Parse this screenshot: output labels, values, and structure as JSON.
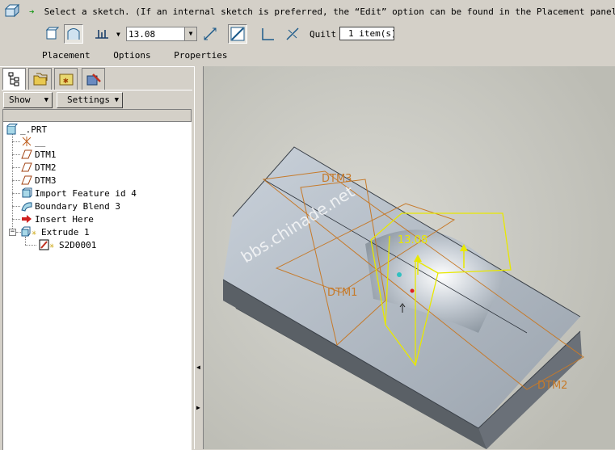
{
  "dashboard": {
    "message": "Select a sketch. (If an internal sketch is preferred, the “Edit” option can be found in the Placement panel.)",
    "depth_value": "13.08",
    "quilt_label": "Quilt",
    "quilt_value": "1 item(s)",
    "slideups": {
      "placement": "Placement",
      "options": "Options",
      "properties": "Properties"
    }
  },
  "tree_toolbar": {
    "show": "Show",
    "settings": "Settings"
  },
  "tree": {
    "root": "_.PRT",
    "items": [
      {
        "label": "__",
        "icon": "csys-icon"
      },
      {
        "label": "DTM1",
        "icon": "datum-plane-icon"
      },
      {
        "label": "DTM2",
        "icon": "datum-plane-icon"
      },
      {
        "label": "DTM3",
        "icon": "datum-plane-icon"
      },
      {
        "label": "Import Feature id 4",
        "icon": "import-feature-icon"
      },
      {
        "label": "Boundary Blend 3",
        "icon": "boundary-blend-icon"
      },
      {
        "label": "Insert Here",
        "icon": "insert-arrow-icon"
      },
      {
        "label": "Extrude 1",
        "icon": "extrude-icon"
      },
      {
        "label": "S2D0001",
        "icon": "sketch-icon"
      }
    ]
  },
  "graphics": {
    "datums": {
      "dtm1": "DTM1",
      "dtm2": "DTM2",
      "dtm3": "DTM3"
    },
    "dimension": "13.08",
    "watermark": "bbs.chinade.net"
  },
  "colors": {
    "datum": "#c67a2a",
    "preview": "#e8e800",
    "part": "#aab3bd"
  }
}
